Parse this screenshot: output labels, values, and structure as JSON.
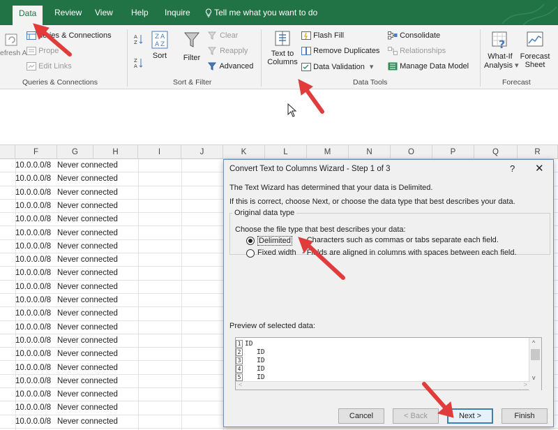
{
  "ribbon_tabs": [
    "Data",
    "Review",
    "View",
    "Help",
    "Inquire"
  ],
  "tell_me": "Tell me what you want to do",
  "ribbon": {
    "queries": {
      "refresh_all": "efresh All",
      "queries_connections": "ueries & Connections",
      "properties": "Prope",
      "edit_links": "Edit Links",
      "group_label": "Queries & Connections"
    },
    "sort_filter": {
      "sort": "Sort",
      "filter": "Filter",
      "clear": "Clear",
      "reapply": "Reapply",
      "advanced": "Advanced",
      "group_label": "Sort & Filter"
    },
    "data_tools": {
      "text_to_columns_1": "Text to",
      "text_to_columns_2": "Columns",
      "flash_fill": "Flash Fill",
      "remove_duplicates": "Remove Duplicates",
      "data_validation": "Data Validation",
      "consolidate": "Consolidate",
      "relationships": "Relationships",
      "manage_data_model": "Manage Data Model",
      "group_label": "Data Tools"
    },
    "forecast": {
      "what_if_1": "What-If",
      "what_if_2": "Analysis",
      "forecast_sheet_1": "Forecast",
      "forecast_sheet_2": "Sheet",
      "group_label": "Forecast"
    }
  },
  "columns": [
    "F",
    "G",
    "H",
    "I",
    "J",
    "K",
    "L",
    "M",
    "N",
    "O",
    "P",
    "Q",
    "R"
  ],
  "rows": [
    {
      "ip": "10.0.0.0/8",
      "status": "Never connected"
    },
    {
      "ip": "10.0.0.0/8",
      "status": "Never connected"
    },
    {
      "ip": "10.0.0.0/8",
      "status": "Never connected"
    },
    {
      "ip": "10.0.0.0/8",
      "status": "Never connected"
    },
    {
      "ip": "10.0.0.0/8",
      "status": "Never connected"
    },
    {
      "ip": "10.0.0.0/8",
      "status": "Never connected"
    },
    {
      "ip": "10.0.0.0/8",
      "status": "Never connected"
    },
    {
      "ip": "10.0.0.0/8",
      "status": "Never connected"
    },
    {
      "ip": "10.0.0.0/8",
      "status": "Never connected"
    },
    {
      "ip": "10.0.0.0/8",
      "status": "Never connected"
    },
    {
      "ip": "10.0.0.0/8",
      "status": "Never connected"
    },
    {
      "ip": "10.0.0.0/8",
      "status": "Never connected"
    },
    {
      "ip": "10.0.0.0/8",
      "status": "Never connected"
    },
    {
      "ip": "10.0.0.0/8",
      "status": "Never connected"
    },
    {
      "ip": "10.0.0.0/8",
      "status": "Never connected"
    },
    {
      "ip": "10.0.0.0/8",
      "status": "Never connected"
    },
    {
      "ip": "10.0.0.0/8",
      "status": "Never connected"
    },
    {
      "ip": "10.0.0.0/8",
      "status": "Never connected"
    },
    {
      "ip": "10.0.0.0/8",
      "status": "Never connected"
    },
    {
      "ip": "10.0.0.0/8",
      "status": "Never connected"
    }
  ],
  "dialog": {
    "title": "Convert Text to Columns Wizard - Step 1 of 3",
    "help": "?",
    "close": "✕",
    "line1": "The Text Wizard has determined that your data is Delimited.",
    "line2": "If this is correct, choose Next, or choose the data type that best describes your data.",
    "group_title": "Original data type",
    "choose_label": "Choose the file type that best describes your data:",
    "delimited_label": "Delimited",
    "delimited_desc": "- Characters such as commas or tabs separate each field.",
    "fixed_label": "Fixed width",
    "fixed_desc": "- Fields are aligned in columns with spaces between each field.",
    "preview_label": "Preview of selected data:",
    "preview_rows": [
      {
        "n": "1",
        "text": "ID"
      },
      {
        "n": "2",
        "text": "   ID"
      },
      {
        "n": "3",
        "text": "   ID"
      },
      {
        "n": "4",
        "text": "   ID"
      },
      {
        "n": "5",
        "text": "   ID"
      }
    ],
    "buttons": {
      "cancel": "Cancel",
      "back": "< Back",
      "next": "Next >",
      "finish": "Finish"
    }
  },
  "colors": {
    "excel_green": "#217346",
    "arrow_red": "#e03c3c"
  }
}
